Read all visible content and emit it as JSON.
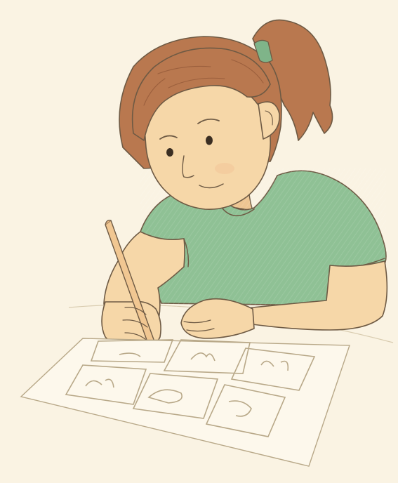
{
  "scene": {
    "type": "illustration",
    "style": "colored-pencil",
    "colors": {
      "background": "#faf3e3",
      "skin": "#f6d7a8",
      "skin_shadow": "#eec592",
      "hair": "#b9784f",
      "hair_dark": "#9b5f3d",
      "shirt": "#8fc195",
      "shirt_dark": "#79ad82",
      "hair_tie": "#7fb489",
      "pencil": "#f1c792",
      "paper": "#fdf8ec",
      "line": "#6e5a44",
      "sketch": "#b8a888"
    },
    "icons": [
      "girl-figure",
      "pencil-icon",
      "worksheet-paper",
      "doodle-panel"
    ]
  }
}
